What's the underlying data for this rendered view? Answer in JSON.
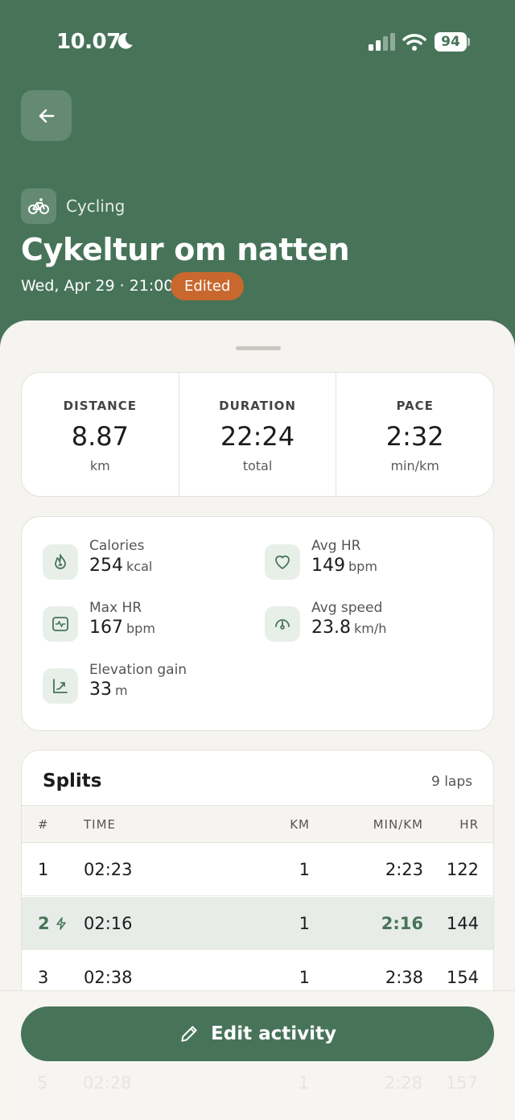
{
  "status_bar": {
    "time": "10.07",
    "battery": "94"
  },
  "activity": {
    "type": "Cycling",
    "title": "Cykeltur om natten",
    "datetime": "Wed, Apr 29 · 21:00",
    "badge": "Edited"
  },
  "stats": [
    {
      "label": "DISTANCE",
      "value": "8.87",
      "unit": "km"
    },
    {
      "label": "DURATION",
      "value": "22:24",
      "unit": "total"
    },
    {
      "label": "PACE",
      "value": "2:32",
      "unit": "min/km"
    }
  ],
  "metrics": {
    "calories": {
      "label": "Calories",
      "value": "254",
      "unit": "kcal",
      "icon": "flame-icon"
    },
    "avg_hr": {
      "label": "Avg HR",
      "value": "149",
      "unit": "bpm",
      "icon": "heart-icon"
    },
    "max_hr": {
      "label": "Max HR",
      "value": "167",
      "unit": "bpm",
      "icon": "heart-rate-monitor-icon"
    },
    "avg_speed": {
      "label": "Avg speed",
      "value": "23.8",
      "unit": "km/h",
      "icon": "speedometer-icon"
    },
    "elevation": {
      "label": "Elevation gain",
      "value": "33",
      "unit": "m",
      "icon": "elevation-chart-icon"
    }
  },
  "splits": {
    "title": "Splits",
    "count": "9 laps",
    "headers": {
      "num": "#",
      "time": "TIME",
      "km": "KM",
      "pace": "MIN/KM",
      "hr": "HR"
    },
    "rows": [
      {
        "num": "1",
        "time": "02:23",
        "km": "1",
        "pace": "2:23",
        "hr": "122"
      },
      {
        "num": "2",
        "time": "02:16",
        "km": "1",
        "pace": "2:16",
        "hr": "144"
      },
      {
        "num": "3",
        "time": "02:38",
        "km": "1",
        "pace": "2:38",
        "hr": "154"
      }
    ],
    "faded_row": {
      "num": "5",
      "time": "02:28",
      "km": "1",
      "pace": "2:28",
      "hr": "157"
    }
  },
  "edit_button": {
    "label": "Edit activity"
  },
  "colors": {
    "header": "#477459",
    "badge": "#c9682e",
    "highlight": "#e7ece8"
  }
}
